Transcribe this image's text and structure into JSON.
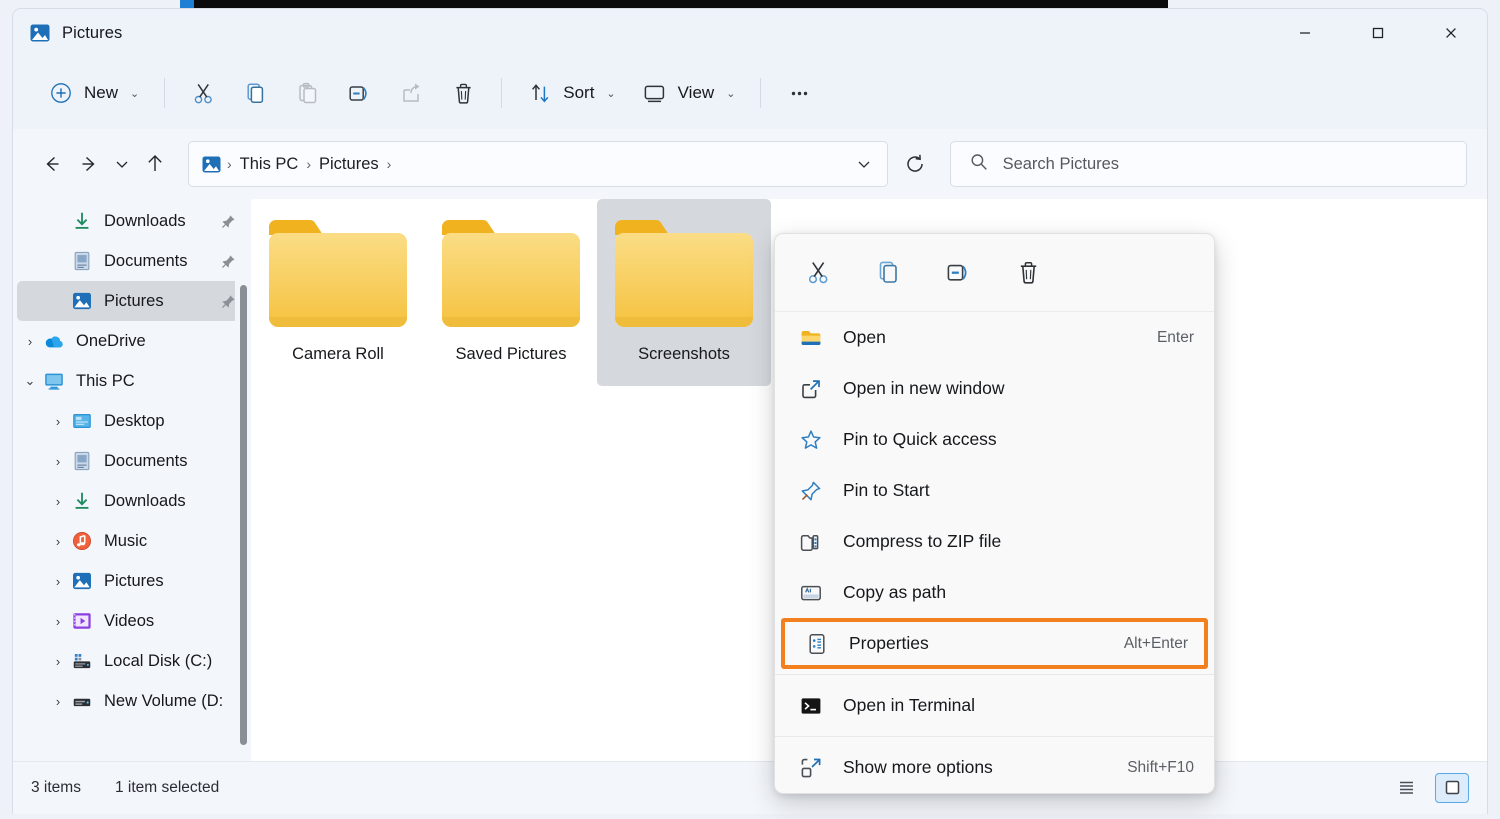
{
  "window": {
    "title": "Pictures",
    "app_icon": "pictures-folder-icon",
    "controls": {
      "minimize": "–",
      "maximize": "☐",
      "close": "✕"
    }
  },
  "toolbar": {
    "new_label": "New",
    "sort_label": "Sort",
    "view_label": "View",
    "more_label": "•••",
    "items": [
      {
        "name": "new-button",
        "label": "New",
        "icon": "plus-circle-icon",
        "has_chevron": true
      },
      {
        "name": "cut-button",
        "label": "",
        "icon": "scissors-icon",
        "has_chevron": false
      },
      {
        "name": "copy-button",
        "label": "",
        "icon": "copy-icon",
        "has_chevron": false
      },
      {
        "name": "paste-button",
        "label": "",
        "icon": "paste-icon",
        "has_chevron": false,
        "disabled": true
      },
      {
        "name": "rename-button",
        "label": "",
        "icon": "rename-icon",
        "has_chevron": false
      },
      {
        "name": "share-button",
        "label": "",
        "icon": "share-icon",
        "has_chevron": false,
        "disabled": true
      },
      {
        "name": "delete-button",
        "label": "",
        "icon": "trash-icon",
        "has_chevron": false
      },
      {
        "name": "sort-button",
        "label": "Sort",
        "icon": "sort-arrows-icon",
        "has_chevron": true
      },
      {
        "name": "view-button",
        "label": "View",
        "icon": "monitor-icon",
        "has_chevron": true
      },
      {
        "name": "see-more-button",
        "label": "",
        "icon": "ellipsis-icon",
        "has_chevron": false
      }
    ]
  },
  "addressbar": {
    "back": "←",
    "forward": "→",
    "recent_chevron": "⌄",
    "up": "↑",
    "breadcrumb_icon": "pictures-folder-icon",
    "crumbs": [
      "This PC",
      "Pictures"
    ],
    "separator": "›",
    "dropdown_chevron": "⌄",
    "refresh": "refresh-icon"
  },
  "search": {
    "placeholder": "Search Pictures",
    "icon": "search-icon"
  },
  "sidebar": {
    "items": [
      {
        "label": "Downloads",
        "icon": "download-icon",
        "indent": 1,
        "twisty": "",
        "pinned": true,
        "selected": false
      },
      {
        "label": "Documents",
        "icon": "documents-icon",
        "indent": 1,
        "twisty": "",
        "pinned": true,
        "selected": false
      },
      {
        "label": "Pictures",
        "icon": "pictures-icon",
        "indent": 1,
        "twisty": "",
        "pinned": true,
        "selected": true
      },
      {
        "label": "OneDrive",
        "icon": "onedrive-icon",
        "indent": 0,
        "twisty": "›",
        "pinned": false,
        "selected": false
      },
      {
        "label": "This PC",
        "icon": "thispc-icon",
        "indent": 0,
        "twisty": "⌄",
        "pinned": false,
        "selected": false
      },
      {
        "label": "Desktop",
        "icon": "desktop-icon",
        "indent": 1,
        "twisty": "›",
        "pinned": false,
        "selected": false
      },
      {
        "label": "Documents",
        "icon": "documents-icon",
        "indent": 1,
        "twisty": "›",
        "pinned": false,
        "selected": false
      },
      {
        "label": "Downloads",
        "icon": "download-icon",
        "indent": 1,
        "twisty": "›",
        "pinned": false,
        "selected": false
      },
      {
        "label": "Music",
        "icon": "music-icon",
        "indent": 1,
        "twisty": "›",
        "pinned": false,
        "selected": false
      },
      {
        "label": "Pictures",
        "icon": "pictures-icon",
        "indent": 1,
        "twisty": "›",
        "pinned": false,
        "selected": false
      },
      {
        "label": "Videos",
        "icon": "videos-icon",
        "indent": 1,
        "twisty": "›",
        "pinned": false,
        "selected": false
      },
      {
        "label": "Local Disk (C:)",
        "icon": "harddisk-icon",
        "indent": 1,
        "twisty": "›",
        "pinned": false,
        "selected": false
      },
      {
        "label": "New Volume (D:",
        "icon": "drive-icon",
        "indent": 1,
        "twisty": "›",
        "pinned": false,
        "selected": false
      }
    ]
  },
  "files": [
    {
      "label": "Camera Roll",
      "icon": "folder-icon",
      "selected": false
    },
    {
      "label": "Saved Pictures",
      "icon": "folder-icon",
      "selected": false
    },
    {
      "label": "Screenshots",
      "icon": "folder-icon",
      "selected": true
    }
  ],
  "context_menu": {
    "toolstrip": [
      {
        "name": "cut-icon-button",
        "icon": "scissors-icon"
      },
      {
        "name": "copy-icon-button",
        "icon": "copy-icon"
      },
      {
        "name": "rename-icon-button",
        "icon": "rename-icon"
      },
      {
        "name": "delete-icon-button",
        "icon": "trash-icon"
      }
    ],
    "items": [
      {
        "label": "Open",
        "accel": "Enter",
        "icon": "folder-open-icon",
        "highlight": false,
        "divider_after": false
      },
      {
        "label": "Open in new window",
        "accel": "",
        "icon": "new-window-icon",
        "highlight": false,
        "divider_after": false
      },
      {
        "label": "Pin to Quick access",
        "accel": "",
        "icon": "star-icon",
        "highlight": false,
        "divider_after": false
      },
      {
        "label": "Pin to Start",
        "accel": "",
        "icon": "pin-icon",
        "highlight": false,
        "divider_after": false
      },
      {
        "label": "Compress to ZIP file",
        "accel": "",
        "icon": "zip-icon",
        "highlight": false,
        "divider_after": false
      },
      {
        "label": "Copy as path",
        "accel": "",
        "icon": "copy-path-icon",
        "highlight": false,
        "divider_after": false
      },
      {
        "label": "Properties",
        "accel": "Alt+Enter",
        "icon": "properties-icon",
        "highlight": true,
        "divider_after": true
      },
      {
        "label": "Open in Terminal",
        "accel": "",
        "icon": "terminal-icon",
        "highlight": false,
        "divider_after": true
      },
      {
        "label": "Show more options",
        "accel": "Shift+F10",
        "icon": "more-options-icon",
        "highlight": false,
        "divider_after": false
      }
    ]
  },
  "statusbar": {
    "item_count": "3 items",
    "selection": "1 item selected",
    "view_buttons": [
      {
        "name": "details-view-button",
        "icon": "list-lines-icon",
        "active": false
      },
      {
        "name": "large-icons-view-button",
        "icon": "large-icon-square-icon",
        "active": true
      }
    ]
  },
  "colors": {
    "accent": "#0f6cbd",
    "highlight_border": "#f2801f",
    "folder_yellow": "#f7cf5e",
    "folder_tab": "#f0b323",
    "selection_gray": "#d5d9de",
    "chrome_bg": "#eef3f9",
    "menu_bg": "#f9f9f9"
  }
}
